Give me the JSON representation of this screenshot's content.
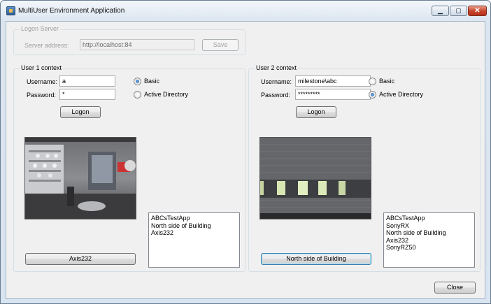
{
  "window": {
    "title": "MultiUser Environment Application"
  },
  "logon_server": {
    "legend": "Logon Server",
    "address_label": "Server address:",
    "address_value": "http://localhost:84",
    "save_label": "Save"
  },
  "user1": {
    "legend": "User 1 context",
    "username_label": "Username:",
    "username_value": "a",
    "password_label": "Password:",
    "password_value": "*",
    "radio_basic": "Basic",
    "radio_ad": "Active Directory",
    "selected_auth": "Basic",
    "logon_label": "Logon",
    "cameras": [
      "ABCsTestApp",
      "North side of Building",
      "Axis232"
    ],
    "camera_button": "Axis232"
  },
  "user2": {
    "legend": "User 2 context",
    "username_label": "Username:",
    "username_value": "milestone\\abc",
    "password_label": "Password:",
    "password_value": "*********",
    "radio_basic": "Basic",
    "radio_ad": "Active Directory",
    "selected_auth": "Active Directory",
    "logon_label": "Logon",
    "cameras": [
      "ABCsTestApp",
      "SonyRX",
      "North side of Building",
      "Axis232",
      "SonyRZ50"
    ],
    "camera_button": "North side of Building"
  },
  "close_label": "Close"
}
